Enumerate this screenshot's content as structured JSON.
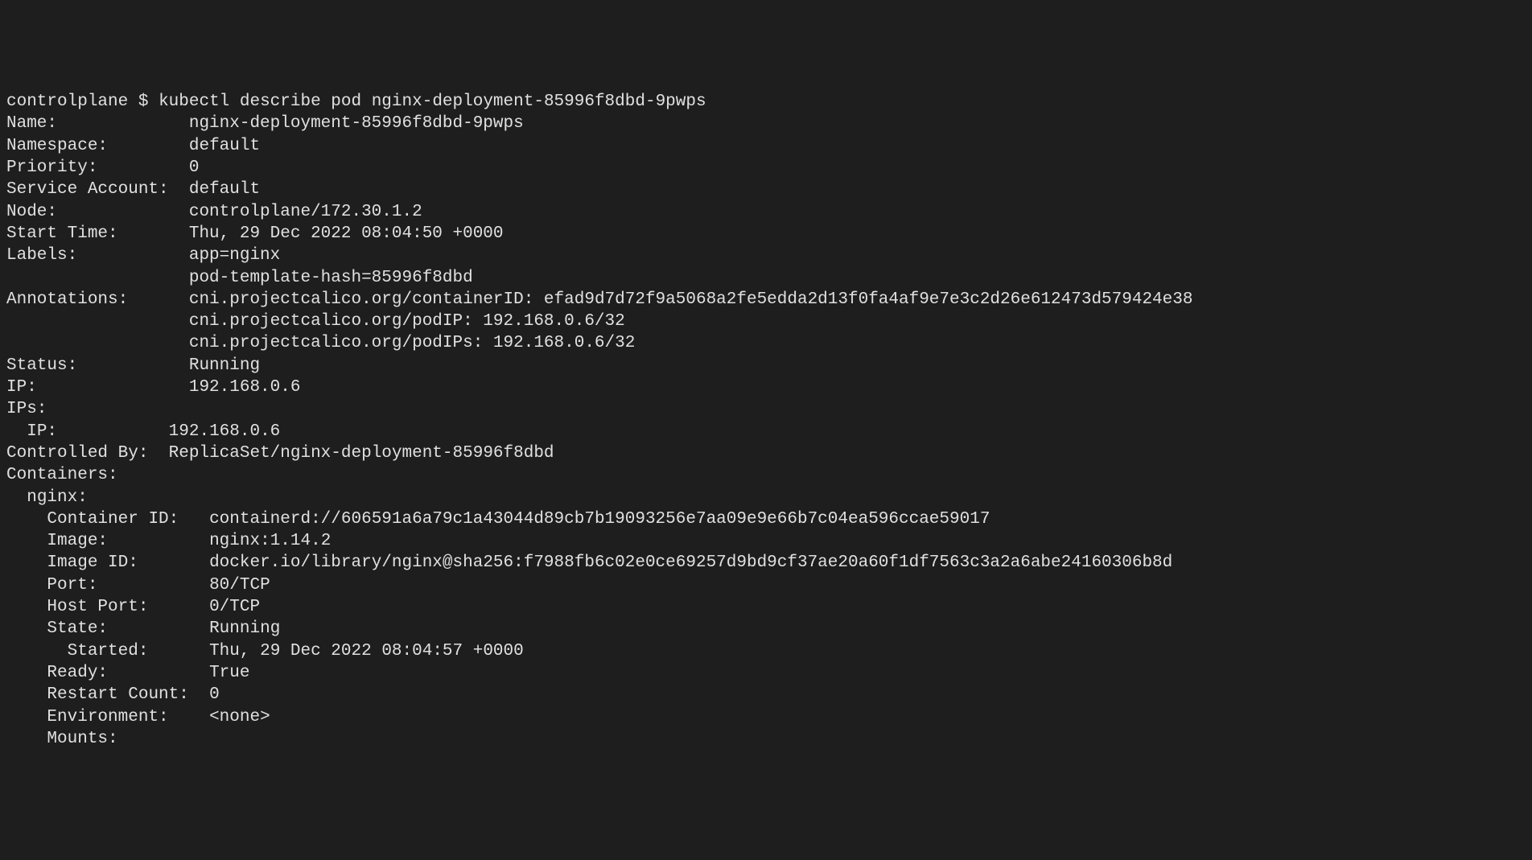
{
  "prompt": {
    "host": "controlplane",
    "symbol": "$",
    "command": "kubectl describe pod nginx-deployment-85996f8dbd-9pwps"
  },
  "pod": {
    "name_label": "Name:",
    "name_value": "nginx-deployment-85996f8dbd-9pwps",
    "namespace_label": "Namespace:",
    "namespace_value": "default",
    "priority_label": "Priority:",
    "priority_value": "0",
    "service_account_label": "Service Account:",
    "service_account_value": "default",
    "node_label": "Node:",
    "node_value": "controlplane/172.30.1.2",
    "start_time_label": "Start Time:",
    "start_time_value": "Thu, 29 Dec 2022 08:04:50 +0000",
    "labels_label": "Labels:",
    "labels_value_1": "app=nginx",
    "labels_value_2": "pod-template-hash=85996f8dbd",
    "annotations_label": "Annotations:",
    "annotations_value_1": "cni.projectcalico.org/containerID: efad9d7d72f9a5068a2fe5edda2d13f0fa4af9e7e3c2d26e612473d579424e38",
    "annotations_value_2": "cni.projectcalico.org/podIP: 192.168.0.6/32",
    "annotations_value_3": "cni.projectcalico.org/podIPs: 192.168.0.6/32",
    "status_label": "Status:",
    "status_value": "Running",
    "ip_label": "IP:",
    "ip_value": "192.168.0.6",
    "ips_label": "IPs:",
    "ips_sub_label": "IP:",
    "ips_sub_value": "192.168.0.6",
    "controlled_by_label": "Controlled By:",
    "controlled_by_value": "ReplicaSet/nginx-deployment-85996f8dbd",
    "containers_label": "Containers:",
    "container": {
      "name": "nginx:",
      "container_id_label": "Container ID:",
      "container_id_value": "containerd://606591a6a79c1a43044d89cb7b19093256e7aa09e9e66b7c04ea596ccae59017",
      "image_label": "Image:",
      "image_value": "nginx:1.14.2",
      "image_id_label": "Image ID:",
      "image_id_value": "docker.io/library/nginx@sha256:f7988fb6c02e0ce69257d9bd9cf37ae20a60f1df7563c3a2a6abe24160306b8d",
      "port_label": "Port:",
      "port_value": "80/TCP",
      "host_port_label": "Host Port:",
      "host_port_value": "0/TCP",
      "state_label": "State:",
      "state_value": "Running",
      "started_label": "Started:",
      "started_value": "Thu, 29 Dec 2022 08:04:57 +0000",
      "ready_label": "Ready:",
      "ready_value": "True",
      "restart_count_label": "Restart Count:",
      "restart_count_value": "0",
      "environment_label": "Environment:",
      "environment_value": "<none>",
      "mounts_label": "Mounts:"
    }
  }
}
